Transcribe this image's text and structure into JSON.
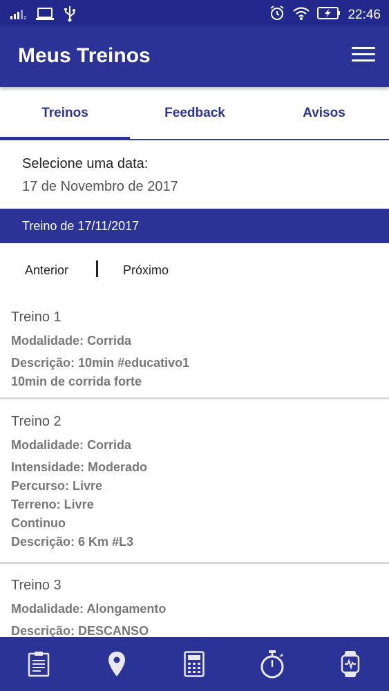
{
  "status_bar": {
    "time": "22:46",
    "icons": [
      "signal-icon",
      "laptop-icon",
      "usb-icon",
      "alarm-icon",
      "wifi-icon",
      "battery-icon"
    ]
  },
  "app_bar": {
    "title": "Meus Treinos",
    "menu_icon": "hamburger-menu-icon"
  },
  "tabs": [
    {
      "label": "Treinos",
      "active": true
    },
    {
      "label": "Feedback",
      "active": false
    },
    {
      "label": "Avisos",
      "active": false
    }
  ],
  "date_picker": {
    "label": "Selecione uma data:",
    "value": "17 de Novembro de 2017"
  },
  "section_header": "Treino de 17/11/2017",
  "pagination": {
    "prev": "Anterior",
    "next": "Próximo"
  },
  "treinos": [
    {
      "title": "Treino 1",
      "lines": [
        "Modalidade: Corrida",
        "Descrição: 10min #educativo1",
        "10min de corrida forte"
      ]
    },
    {
      "title": "Treino 2",
      "lines": [
        "Modalidade: Corrida",
        "Intensidade: Moderado",
        "Percurso: Livre",
        "Terreno: Livre",
        "Continuo",
        "Descrição: 6 Km #L3"
      ]
    },
    {
      "title": "Treino 3",
      "lines": [
        "Modalidade: Alongamento",
        "Descrição: DESCANSO"
      ]
    }
  ],
  "bottom_nav": [
    "clipboard-icon",
    "location-pin-icon",
    "calculator-icon",
    "stopwatch-icon",
    "smartwatch-icon"
  ],
  "colors": {
    "primary": "#2b3396",
    "status_bar": "#23298c",
    "secondary_text": "#777777"
  }
}
